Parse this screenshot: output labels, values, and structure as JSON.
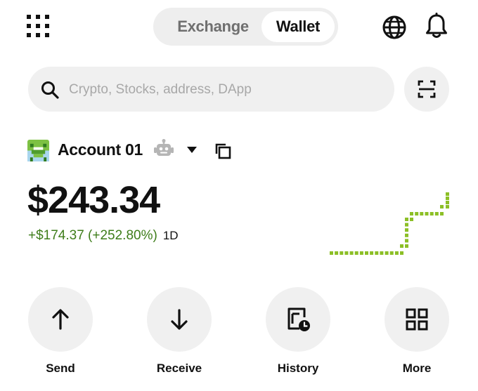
{
  "header": {
    "tabs": [
      {
        "label": "Exchange",
        "active": false
      },
      {
        "label": "Wallet",
        "active": true
      }
    ],
    "icons": [
      "apps-grid-icon",
      "globe-icon",
      "bell-icon"
    ]
  },
  "search": {
    "placeholder": "Crypto, Stocks, address, DApp",
    "value": ""
  },
  "account": {
    "name": "Account 01"
  },
  "balance": {
    "amount": "$243.34",
    "change": "+$174.37 (+252.80%)",
    "period": "1D"
  },
  "actions": [
    {
      "label": "Send",
      "icon": "arrow-up-icon"
    },
    {
      "label": "Receive",
      "icon": "arrow-down-icon"
    },
    {
      "label": "History",
      "icon": "history-icon"
    },
    {
      "label": "More",
      "icon": "more-grid-icon"
    }
  ],
  "colors": {
    "accent_green": "#3e7d1a",
    "sparkline": "#8cbf26",
    "pill_bg": "#f0f0f0"
  }
}
